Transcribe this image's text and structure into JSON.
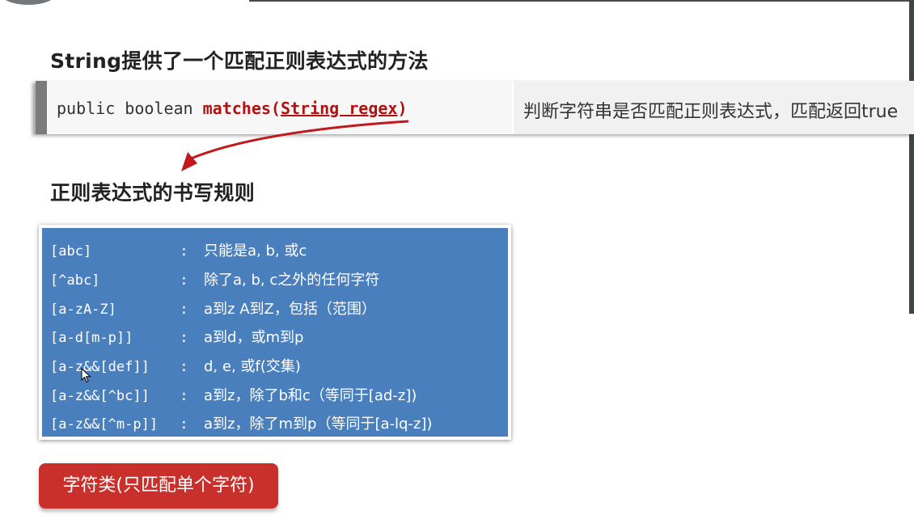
{
  "headings": {
    "string_methods": "String提供了一个匹配正则表达式的方法",
    "regex_rules": "正则表达式的书写规则"
  },
  "method": {
    "prefix": "public boolean ",
    "name_open": "matches(",
    "param": "String regex",
    "name_close": ")",
    "description": "判断字符串是否匹配正则表达式，匹配返回true"
  },
  "rules": [
    {
      "pattern": "[abc]",
      "colon": ":",
      "explanation": "只能是a, b, 或c"
    },
    {
      "pattern": "[^abc]",
      "colon": ":",
      "explanation": "除了a, b, c之外的任何字符"
    },
    {
      "pattern": "[a-zA-Z]",
      "colon": ":",
      "explanation": "a到z A到Z，包括（范围）"
    },
    {
      "pattern": "[a-d[m-p]]",
      "colon": ":",
      "explanation": "a到d，或m到p"
    },
    {
      "pattern": "[a-z&&[def]]",
      "colon": ":",
      "explanation": "d, e, 或f(交集)"
    },
    {
      "pattern": "[a-z&&[^bc]]",
      "colon": ":",
      "explanation": "a到z，除了b和c（等同于[ad-z])"
    },
    {
      "pattern": "[a-z&&[^m-p]]",
      "colon": ":",
      "explanation": "a到z，除了m到p（等同于[a-lq-z])"
    }
  ],
  "badge": {
    "label": "字符类(只匹配单个字符)"
  },
  "colors": {
    "method_name": "#b01212",
    "rules_background": "#4a7fbe",
    "badge_background": "#c9302c",
    "arrow": "#c0181c"
  },
  "icons": {
    "arrow": "curved-arrow-icon",
    "cursor": "mouse-pointer-icon"
  }
}
